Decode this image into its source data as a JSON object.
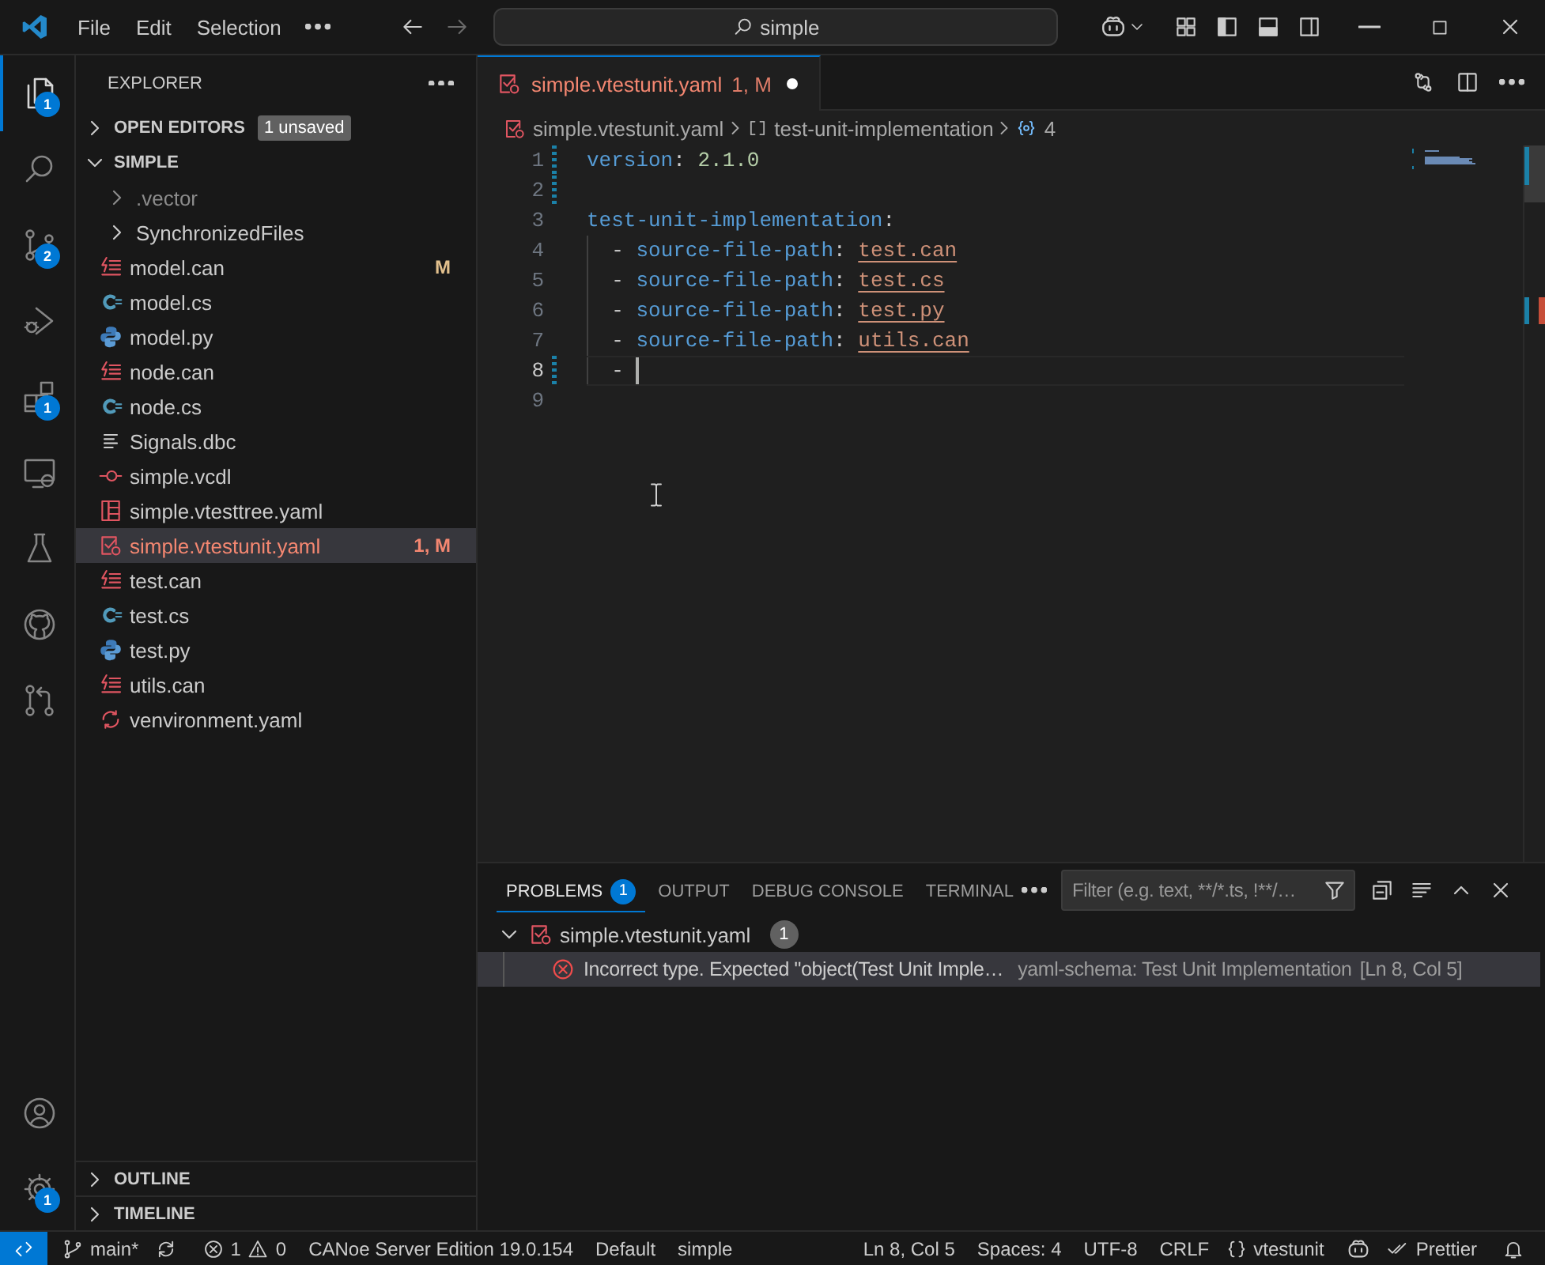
{
  "title_bar": {
    "menus": [
      "File",
      "Edit",
      "Selection"
    ],
    "search": "simple"
  },
  "activity_bar": {
    "items": [
      {
        "kind": "explorer",
        "badge": "1",
        "selected": true
      },
      {
        "kind": "search",
        "selected": false
      },
      {
        "kind": "source-control",
        "badge": "2",
        "selected": false
      },
      {
        "kind": "debug",
        "selected": false
      },
      {
        "kind": "extensions",
        "badge": "1",
        "selected": false
      },
      {
        "kind": "remote",
        "selected": false
      },
      {
        "kind": "testing",
        "selected": false
      },
      {
        "kind": "github",
        "selected": false
      },
      {
        "kind": "pull-requests",
        "selected": false
      }
    ],
    "bottom": [
      {
        "kind": "account",
        "selected": false
      },
      {
        "kind": "settings",
        "badge": "1",
        "selected": false
      }
    ]
  },
  "sidebar": {
    "title": "EXPLORER",
    "open_editors": {
      "label": "OPEN EDITORS",
      "badge": "1 unsaved",
      "expanded": false
    },
    "folder": {
      "label": "SIMPLE",
      "expanded": true,
      "children": [
        {
          "name": ".vector",
          "kind": "folder",
          "expanded": false,
          "ignored": true,
          "error": false,
          "selected": false
        },
        {
          "name": "SynchronizedFiles",
          "kind": "folder",
          "expanded": false,
          "ignored": false,
          "error": false,
          "selected": false
        },
        {
          "name": "model.can",
          "kind": "can",
          "decoration": "M",
          "ignored": false,
          "error": false,
          "selected": false
        },
        {
          "name": "model.cs",
          "kind": "cs",
          "ignored": false,
          "error": false,
          "selected": false
        },
        {
          "name": "model.py",
          "kind": "py",
          "ignored": false,
          "error": false,
          "selected": false
        },
        {
          "name": "node.can",
          "kind": "can",
          "ignored": false,
          "error": false,
          "selected": false
        },
        {
          "name": "node.cs",
          "kind": "cs",
          "ignored": false,
          "error": false,
          "selected": false
        },
        {
          "name": "Signals.dbc",
          "kind": "dbc",
          "ignored": false,
          "error": false,
          "selected": false
        },
        {
          "name": "simple.vcdl",
          "kind": "vcdl",
          "ignored": false,
          "error": false,
          "selected": false
        },
        {
          "name": "simple.vtesttree.yaml",
          "kind": "vtesttree",
          "ignored": false,
          "error": false,
          "selected": false
        },
        {
          "name": "simple.vtestunit.yaml",
          "kind": "vtestunit",
          "decoration": "1, M",
          "ignored": false,
          "error": true,
          "selected": true
        },
        {
          "name": "test.can",
          "kind": "can",
          "ignored": false,
          "error": false,
          "selected": false
        },
        {
          "name": "test.cs",
          "kind": "cs",
          "ignored": false,
          "error": false,
          "selected": false
        },
        {
          "name": "test.py",
          "kind": "py",
          "ignored": false,
          "error": false,
          "selected": false
        },
        {
          "name": "utils.can",
          "kind": "can",
          "ignored": false,
          "error": false,
          "selected": false
        },
        {
          "name": "venvironment.yaml",
          "kind": "venv",
          "ignored": false,
          "error": false,
          "selected": false
        }
      ]
    },
    "outline": {
      "label": "OUTLINE",
      "expanded": false
    },
    "timeline": {
      "label": "TIMELINE",
      "expanded": false
    }
  },
  "editor": {
    "tabs": [
      {
        "label": "simple.vtestunit.yaml",
        "decoration": "1, M",
        "kind": "vtestunit",
        "dirty": true,
        "error": true,
        "selected": true
      }
    ],
    "breadcrumbs": [
      {
        "kind": "vtestunit",
        "text": "simple.vtestunit.yaml"
      },
      {
        "kind": "array",
        "text": "test-unit-implementation"
      },
      {
        "kind": "object",
        "text": "4"
      }
    ],
    "lines": [
      {
        "number": "1",
        "changed": true,
        "current": false,
        "indent_guide": false,
        "tokens": [
          {
            "kind": "key",
            "text": "version"
          },
          {
            "kind": "punct",
            "text": ": "
          },
          {
            "kind": "scalar",
            "text": "2.1.0"
          }
        ]
      },
      {
        "number": "2",
        "changed": true
      },
      {
        "number": "3",
        "changed": false,
        "current": false,
        "indent_guide": false,
        "tokens": [
          {
            "kind": "key",
            "text": "test-unit-implementation"
          },
          {
            "kind": "punct",
            "text": ":"
          }
        ]
      },
      {
        "number": "4",
        "changed": false,
        "current": false,
        "indent_guide": true,
        "tokens": [
          {
            "kind": "punct",
            "text": "  - "
          },
          {
            "kind": "key",
            "text": "source-file-path"
          },
          {
            "kind": "punct",
            "text": ": "
          },
          {
            "kind": "link",
            "text": "test.can"
          }
        ]
      },
      {
        "number": "5",
        "changed": false,
        "current": false,
        "indent_guide": true,
        "tokens": [
          {
            "kind": "punct",
            "text": "  - "
          },
          {
            "kind": "key",
            "text": "source-file-path"
          },
          {
            "kind": "punct",
            "text": ": "
          },
          {
            "kind": "link",
            "text": "test.cs"
          }
        ]
      },
      {
        "number": "6",
        "changed": false,
        "current": false,
        "indent_guide": true,
        "tokens": [
          {
            "kind": "punct",
            "text": "  - "
          },
          {
            "kind": "key",
            "text": "source-file-path"
          },
          {
            "kind": "punct",
            "text": ": "
          },
          {
            "kind": "link",
            "text": "test.py"
          }
        ]
      },
      {
        "number": "7",
        "changed": false,
        "current": false,
        "indent_guide": true,
        "tokens": [
          {
            "kind": "punct",
            "text": "  - "
          },
          {
            "kind": "key",
            "text": "source-file-path"
          },
          {
            "kind": "punct",
            "text": ": "
          },
          {
            "kind": "link",
            "text": "utils.can"
          }
        ]
      },
      {
        "number": "8",
        "changed": true,
        "current": true,
        "indent_guide": true,
        "tokens": [
          {
            "kind": "punct",
            "text": "  - "
          }
        ]
      },
      {
        "number": "9",
        "changed": false
      }
    ]
  },
  "panel": {
    "tabs": [
      {
        "label": "PROBLEMS",
        "badge": "1",
        "selected": true
      },
      {
        "label": "OUTPUT",
        "selected": false
      },
      {
        "label": "DEBUG CONSOLE",
        "selected": false
      },
      {
        "label": "TERMINAL",
        "selected": false
      }
    ],
    "filter": {
      "placeholder": "Filter (e.g. text, **/*.ts, !**/…"
    },
    "groups": [
      {
        "file": "simple.vtestunit.yaml",
        "count": "1",
        "expanded": true,
        "problems": [
          {
            "message": "Incorrect type. Expected \"object(Test Unit Imple…",
            "source": "yaml-schema: Test Unit Implementation",
            "location": "[Ln 8, Col 5]",
            "selected": true
          }
        ]
      }
    ]
  },
  "status_bar": {
    "left": [
      {
        "kind": "remote"
      },
      {
        "kind": "branch",
        "text": "main*"
      },
      {
        "kind": "sync"
      },
      {
        "kind": "problems",
        "errors": "1",
        "warnings": "0"
      },
      {
        "kind": "text",
        "text": "CANoe Server Edition 19.0.154"
      },
      {
        "kind": "text",
        "text": "Default"
      },
      {
        "kind": "text",
        "text": "simple"
      }
    ],
    "right": [
      {
        "kind": "text",
        "text": "Ln 8, Col 5"
      },
      {
        "kind": "text",
        "text": "Spaces: 4"
      },
      {
        "kind": "text",
        "text": "UTF-8"
      },
      {
        "kind": "text",
        "text": "CRLF"
      },
      {
        "kind": "language",
        "text": "vtestunit"
      },
      {
        "kind": "copilot"
      },
      {
        "kind": "prettier",
        "text": "Prettier"
      },
      {
        "kind": "bell"
      }
    ]
  }
}
